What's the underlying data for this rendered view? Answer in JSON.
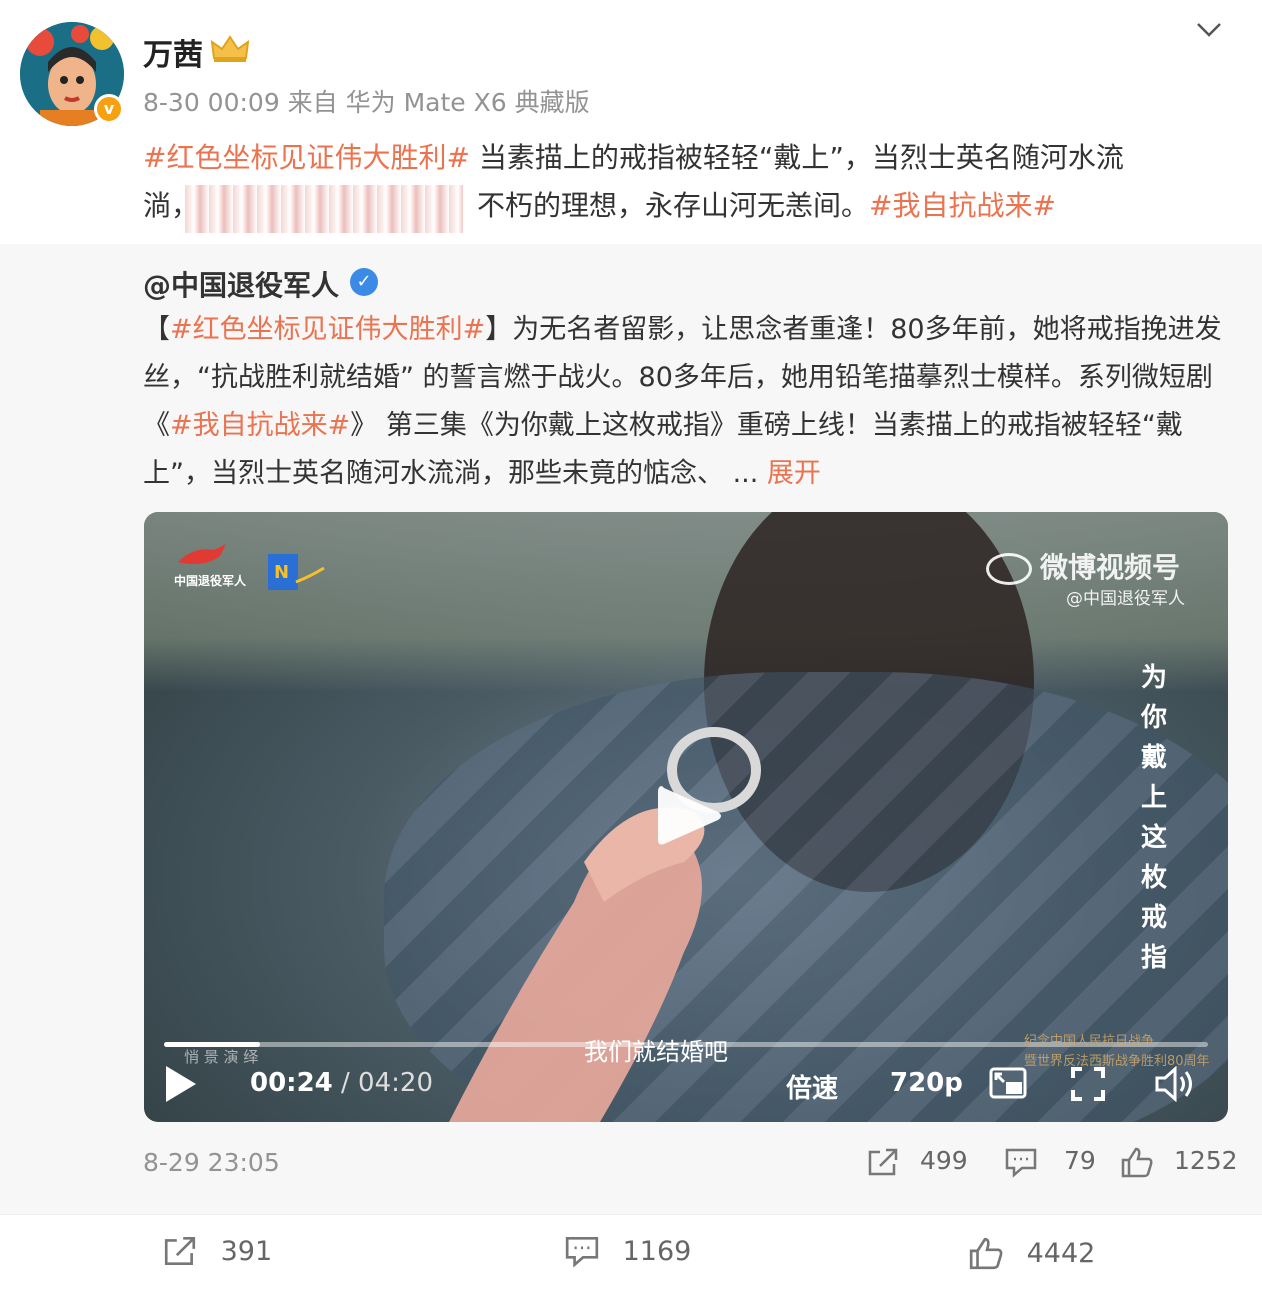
{
  "post": {
    "username": "万茜",
    "meta": "8-30 00:09 来自 华为 Mate X6 典藏版",
    "text": {
      "tag1": "#红色坐标见证伟大胜利#",
      "part1": " 当素描上的戒指被轻轻“戴上”，当烈士英名随河水流",
      "line2_start": "淌，",
      "line2_mid": "不朽的理想，永存山河无恙间。",
      "tag2": "#我自抗战来#"
    }
  },
  "repost": {
    "username": "@中国退役军人",
    "text": {
      "bracket_open": "【",
      "tag1": "#红色坐标见证伟大胜利#",
      "part1": "】为无名者留影，让思念者重逢！80多年前，她将戒指挽进发丝，“抗战胜利就结婚” 的誓言燃于战火。80多年后，她用铅笔描摹烈士模样。系列微短剧《",
      "tag2": "#我自抗战来#",
      "part2": "》 第三集《为你戴上这枚戒指》重磅上线！当素描上的戒指被轻轻“戴上”，当烈士英名随河水流淌，那些未竟的惦念、  ... ",
      "expand": "展开"
    },
    "video": {
      "logo_text": "中国退役军人",
      "watermark": "微博视频号",
      "watermark_sub": "@中国退役军人",
      "vertical_title": "为你戴上这枚戒指",
      "subtitle": "我们就结婚吧",
      "current_time": "00:24",
      "total_time": " / 04:20",
      "progress": 0.092,
      "speed_label": "倍速",
      "quality_label": "720p"
    },
    "time": "8-29 23:05",
    "shares": "499",
    "comments": "79",
    "likes": "1252"
  },
  "bottom_bar": {
    "shares": "391",
    "comments": "1169",
    "likes": "4442"
  },
  "colors": {
    "tag": "#eb7350",
    "meta_gray": "#939393",
    "verified_orange": "#f7a012",
    "verified_blue": "#3b8ae6"
  }
}
